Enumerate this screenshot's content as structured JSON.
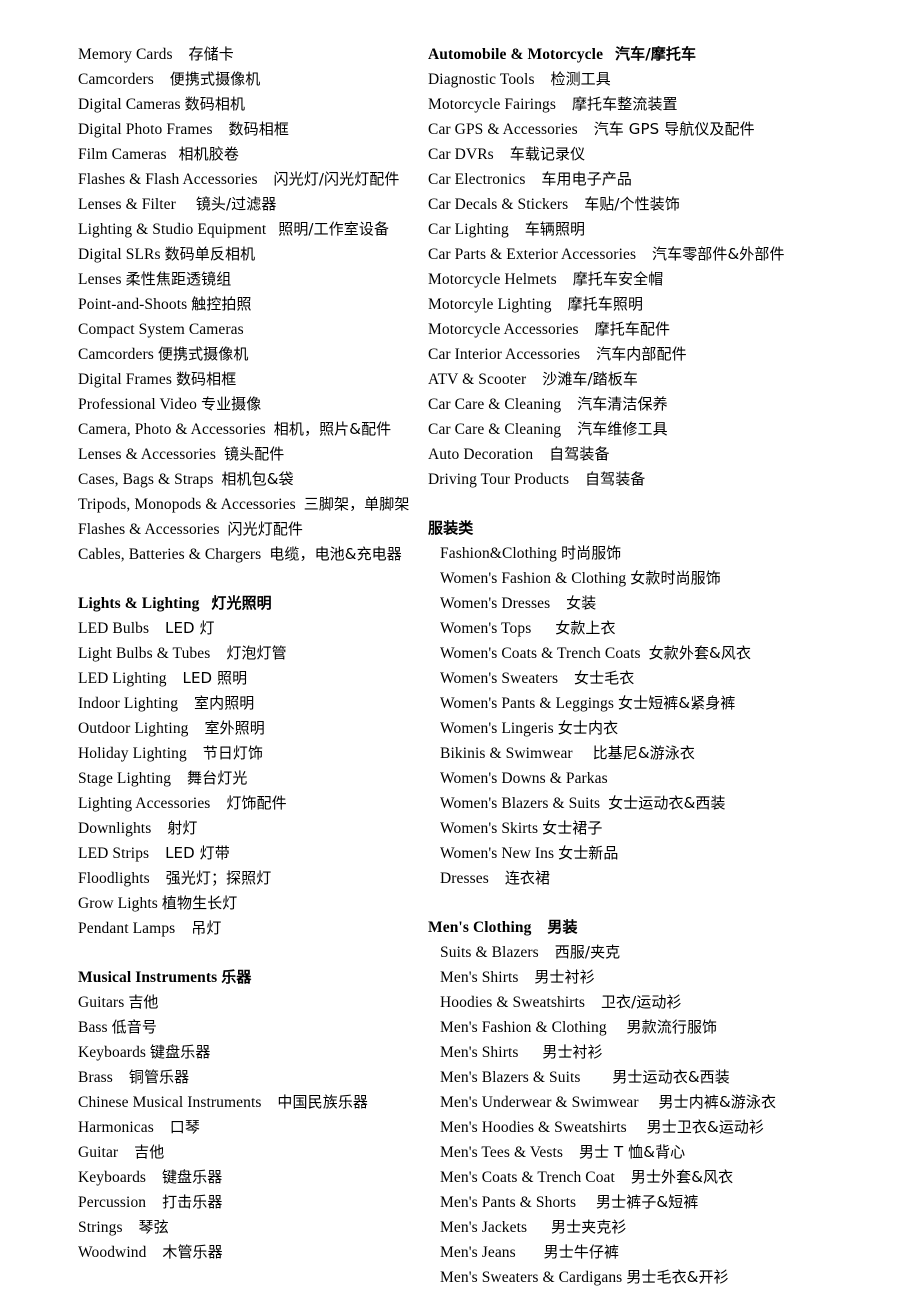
{
  "document": {
    "type": "bilingual-category-list",
    "language_pair": "English / Chinese",
    "columns": [
      {
        "id": "left-column",
        "blocks": [
          {
            "id": "camera-photo-continued",
            "kind": "list",
            "items": [
              {
                "en": "Memory Cards",
                "gap": "    ",
                "zh": "存储卡"
              },
              {
                "en": "Camcorders",
                "gap": "    ",
                "zh": "便携式摄像机"
              },
              {
                "en": "Digital Cameras",
                "gap": " ",
                "zh": "数码相机"
              },
              {
                "en": "Digital Photo Frames",
                "gap": "    ",
                "zh": "数码相框"
              },
              {
                "en": "Film Cameras",
                "gap": "   ",
                "zh": "相机胶卷"
              },
              {
                "en": "Flashes & Flash Accessories",
                "gap": "    ",
                "zh": "闪光灯/闪光灯配件"
              },
              {
                "en": "Lenses & Filter",
                "gap": "     ",
                "zh": "镜头/过滤器"
              },
              {
                "en": "Lighting & Studio Equipment",
                "gap": "   ",
                "zh": "照明/工作室设备"
              },
              {
                "en": "Digital SLRs",
                "gap": " ",
                "zh": "数码单反相机"
              },
              {
                "en": "Lenses",
                "gap": " ",
                "zh": "柔性焦距透镜组"
              },
              {
                "en": "Point-and-Shoots",
                "gap": " ",
                "zh": "触控拍照"
              },
              {
                "en": "Compact System Cameras",
                "gap": "",
                "zh": ""
              },
              {
                "en": "Camcorders",
                "gap": " ",
                "zh": "便携式摄像机"
              },
              {
                "en": "Digital Frames",
                "gap": " ",
                "zh": "数码相框"
              },
              {
                "en": "Professional Video",
                "gap": " ",
                "zh": "专业摄像"
              },
              {
                "en": "Camera, Photo & Accessories",
                "gap": "  ",
                "zh": "相机，照片&配件"
              },
              {
                "en": "Lenses & Accessories",
                "gap": "  ",
                "zh": "镜头配件"
              },
              {
                "en": "Cases, Bags & Straps",
                "gap": "  ",
                "zh": "相机包&袋"
              },
              {
                "en": "Tripods, Monopods & Accessories",
                "gap": "  ",
                "zh": "三脚架，单脚架"
              },
              {
                "en": "Flashes & Accessories",
                "gap": "  ",
                "zh": "闪光灯配件"
              },
              {
                "en": "Cables, Batteries & Chargers",
                "gap": "  ",
                "zh": "电缆，电池&充电器"
              }
            ]
          },
          {
            "id": "lights-lighting",
            "kind": "section",
            "header": {
              "en": "Lights & Lighting",
              "gap": "   ",
              "zh": "灯光照明"
            },
            "items": [
              {
                "en": "LED Bulbs",
                "gap": "    ",
                "zh": "LED 灯"
              },
              {
                "en": "Light Bulbs & Tubes",
                "gap": "    ",
                "zh": "灯泡灯管"
              },
              {
                "en": "LED Lighting",
                "gap": "    ",
                "zh": "LED 照明"
              },
              {
                "en": "Indoor Lighting",
                "gap": "    ",
                "zh": "室内照明"
              },
              {
                "en": "Outdoor Lighting",
                "gap": "    ",
                "zh": "室外照明"
              },
              {
                "en": "Holiday Lighting",
                "gap": "    ",
                "zh": "节日灯饰"
              },
              {
                "en": "Stage Lighting",
                "gap": "    ",
                "zh": "舞台灯光"
              },
              {
                "en": "Lighting Accessories",
                "gap": "    ",
                "zh": "灯饰配件"
              },
              {
                "en": "Downlights",
                "gap": "    ",
                "zh": "射灯"
              },
              {
                "en": "LED Strips",
                "gap": "    ",
                "zh": "LED 灯带"
              },
              {
                "en": "Floodlights",
                "gap": "    ",
                "zh": "强光灯；探照灯"
              },
              {
                "en": "Grow Lights",
                "gap": " ",
                "zh": "植物生长灯"
              },
              {
                "en": "Pendant Lamps",
                "gap": "    ",
                "zh": "吊灯"
              }
            ]
          },
          {
            "id": "musical-instruments",
            "kind": "section",
            "header": {
              "en": "Musical Instruments",
              "gap": " ",
              "zh": "乐器"
            },
            "items": [
              {
                "en": "Guitars",
                "gap": " ",
                "zh": "吉他"
              },
              {
                "en": "Bass",
                "gap": " ",
                "zh": "低音号"
              },
              {
                "en": "Keyboards",
                "gap": " ",
                "zh": "键盘乐器"
              },
              {
                "en": "Brass",
                "gap": "    ",
                "zh": "铜管乐器"
              },
              {
                "en": "Chinese Musical Instruments",
                "gap": "    ",
                "zh": "中国民族乐器"
              },
              {
                "en": "Harmonicas",
                "gap": "    ",
                "zh": "口琴"
              },
              {
                "en": "Guitar",
                "gap": "    ",
                "zh": "吉他"
              },
              {
                "en": "Keyboards",
                "gap": "    ",
                "zh": "键盘乐器"
              },
              {
                "en": "Percussion",
                "gap": "    ",
                "zh": "打击乐器"
              },
              {
                "en": "Strings",
                "gap": "    ",
                "zh": "琴弦"
              },
              {
                "en": "Woodwind",
                "gap": "    ",
                "zh": "木管乐器"
              }
            ]
          }
        ]
      },
      {
        "id": "right-column",
        "blocks": [
          {
            "id": "automobile-motorcycle",
            "kind": "section",
            "header": {
              "en": "Automobile & Motorcycle",
              "gap": "   ",
              "zh": "汽车/摩托车"
            },
            "items": [
              {
                "en": "Diagnostic Tools",
                "gap": "    ",
                "zh": "检测工具"
              },
              {
                "en": "Motorcycle Fairings",
                "gap": "    ",
                "zh": "摩托车整流装置"
              },
              {
                "en": "Car GPS & Accessories",
                "gap": "    ",
                "zh": "汽车 GPS 导航仪及配件"
              },
              {
                "en": "Car DVRs",
                "gap": "    ",
                "zh": "车载记录仪"
              },
              {
                "en": "Car Electronics",
                "gap": "    ",
                "zh": "车用电子产品"
              },
              {
                "en": "Car Decals & Stickers",
                "gap": "    ",
                "zh": "车贴/个性装饰"
              },
              {
                "en": "Car Lighting",
                "gap": "    ",
                "zh": "车辆照明"
              },
              {
                "en": "Car Parts & Exterior Accessories",
                "gap": "    ",
                "zh": "汽车零部件&外部件"
              },
              {
                "en": "Motorcycle Helmets",
                "gap": "    ",
                "zh": "摩托车安全帽"
              },
              {
                "en": "Motorcyle Lighting",
                "gap": "    ",
                "zh": "摩托车照明"
              },
              {
                "en": "Motorcycle Accessories",
                "gap": "    ",
                "zh": "摩托车配件"
              },
              {
                "en": "Car Interior Accessories",
                "gap": "    ",
                "zh": "汽车内部配件"
              },
              {
                "en": "ATV & Scooter",
                "gap": "    ",
                "zh": "沙滩车/踏板车"
              },
              {
                "en": "Car Care & Cleaning",
                "gap": "    ",
                "zh": "汽车清洁保养"
              },
              {
                "en": "Car Care & Cleaning",
                "gap": "    ",
                "zh": "汽车维修工具"
              },
              {
                "en": "Auto Decoration",
                "gap": "    ",
                "zh": "自驾装备"
              },
              {
                "en": "Driving Tour Products",
                "gap": "    ",
                "zh": "自驾装备"
              }
            ]
          },
          {
            "id": "fashion-clothing",
            "kind": "section",
            "header": {
              "en": "",
              "gap": "",
              "zh": "服装类"
            },
            "indent_items": true,
            "items": [
              {
                "en": "Fashion&Clothing",
                "gap": " ",
                "zh": "时尚服饰"
              },
              {
                "en": "Women's Fashion & Clothing",
                "gap": " ",
                "zh": "女款时尚服饰"
              },
              {
                "en": "Women's Dresses",
                "gap": "    ",
                "zh": "女装"
              },
              {
                "en": "Women's Tops",
                "gap": "      ",
                "zh": "女款上衣"
              },
              {
                "en": "Women's Coats & Trench Coats",
                "gap": "  ",
                "zh": "女款外套&风衣"
              },
              {
                "en": "Women's Sweaters",
                "gap": "    ",
                "zh": "女士毛衣"
              },
              {
                "en": "Women's Pants & Leggings",
                "gap": " ",
                "zh": "女士短裤&紧身裤"
              },
              {
                "en": "Women's Lingeris",
                "gap": " ",
                "zh": "女士内衣"
              },
              {
                "en": "Bikinis & Swimwear",
                "gap": "     ",
                "zh": "比基尼&游泳衣"
              },
              {
                "en": "Women's Downs & Parkas",
                "gap": "",
                "zh": ""
              },
              {
                "en": "Women's Blazers & Suits",
                "gap": "  ",
                "zh": "女士运动衣&西装"
              },
              {
                "en": "Women's Skirts",
                "gap": " ",
                "zh": "女士裙子"
              },
              {
                "en": "Women's New Ins",
                "gap": " ",
                "zh": "女士新品"
              },
              {
                "en": "Dresses",
                "gap": "    ",
                "zh": "连衣裙"
              }
            ]
          },
          {
            "id": "mens-clothing",
            "kind": "section",
            "header": {
              "en": "Men's Clothing",
              "gap": "    ",
              "zh": "男装"
            },
            "indent_items": true,
            "items": [
              {
                "en": "Suits & Blazers",
                "gap": "    ",
                "zh": "西服/夹克"
              },
              {
                "en": "Men's Shirts",
                "gap": "    ",
                "zh": "男士衬衫"
              },
              {
                "en": "Hoodies & Sweatshirts",
                "gap": "    ",
                "zh": "卫衣/运动衫"
              },
              {
                "en": "Men's Fashion & Clothing",
                "gap": "     ",
                "zh": "男款流行服饰"
              },
              {
                "en": "Men's Shirts",
                "gap": "      ",
                "zh": "男士衬衫"
              },
              {
                "en": "Men's Blazers & Suits",
                "gap": "        ",
                "zh": "男士运动衣&西装"
              },
              {
                "en": "Men's Underwear & Swimwear",
                "gap": "     ",
                "zh": "男士内裤&游泳衣"
              },
              {
                "en": "Men's Hoodies & Sweatshirts",
                "gap": "     ",
                "zh": "男士卫衣&运动衫"
              },
              {
                "en": "Men's Tees & Vests",
                "gap": "    ",
                "zh": "男士 T 恤&背心"
              },
              {
                "en": "Men's Coats & Trench Coat",
                "gap": "    ",
                "zh": "男士外套&风衣"
              },
              {
                "en": "Men's Pants & Shorts",
                "gap": "     ",
                "zh": "男士裤子&短裤"
              },
              {
                "en": "Men's Jackets",
                "gap": "      ",
                "zh": "男士夹克衫"
              },
              {
                "en": "Men's Jeans",
                "gap": "       ",
                "zh": "男士牛仔裤"
              },
              {
                "en": "Men's Sweaters & Cardigans",
                "gap": " ",
                "zh": "男士毛衣&开衫"
              }
            ]
          }
        ]
      }
    ]
  }
}
